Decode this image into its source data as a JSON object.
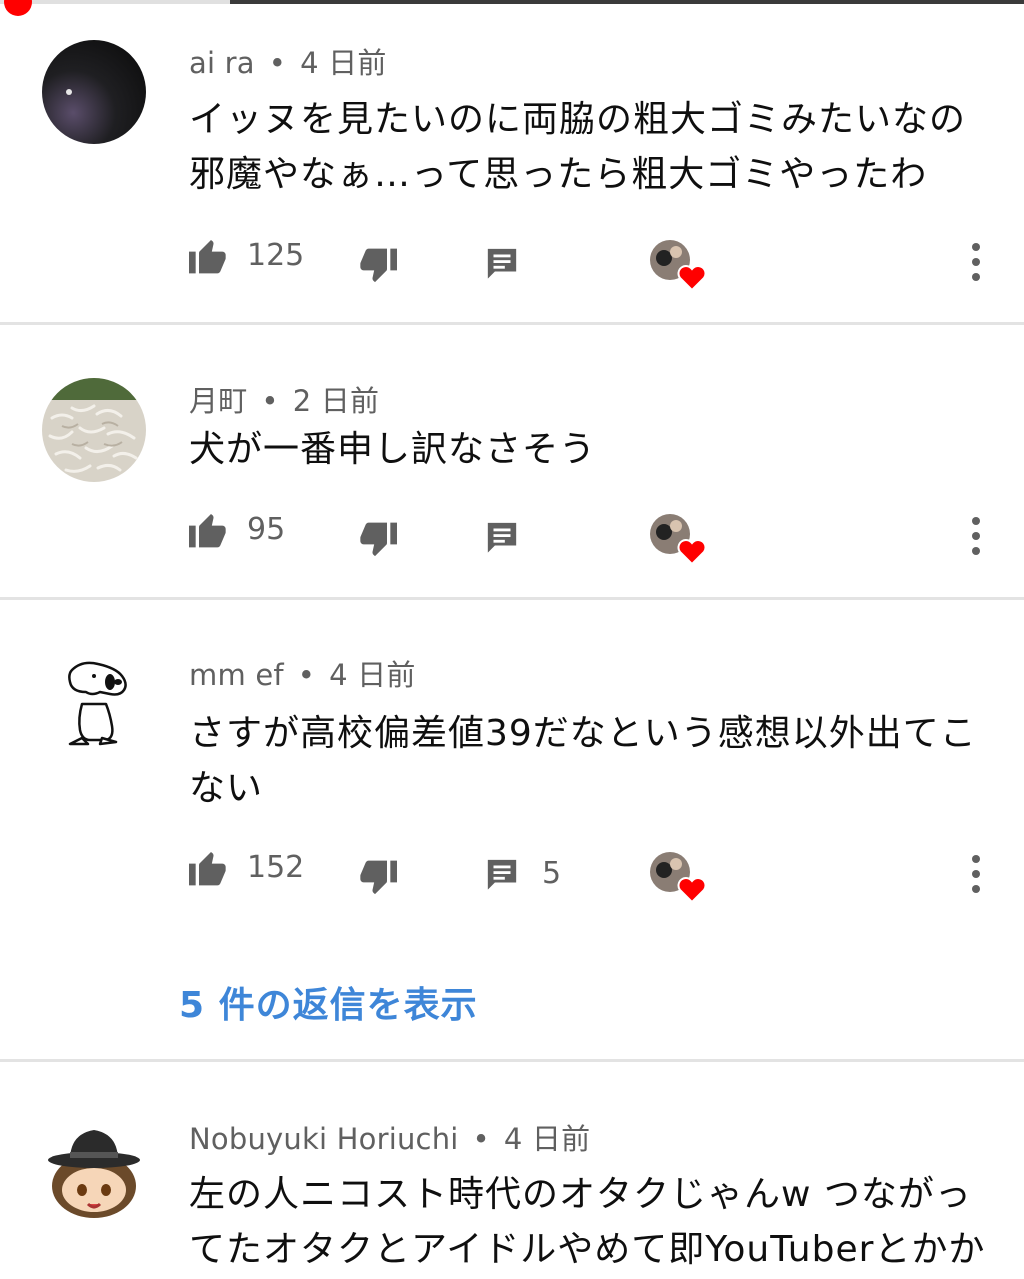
{
  "comments": [
    {
      "author": "ai ra",
      "time": "4 日前",
      "text_lines": [
        "イッヌを見たいのに両脇の粗大ゴミみたいなの",
        "邪魔やなぁ…って思ったら粗大ゴミやったわ"
      ],
      "likes": "125",
      "replies": ""
    },
    {
      "author": "月町",
      "time": "2 日前",
      "text_lines": [
        "犬が一番申し訳なさそう"
      ],
      "likes": "95",
      "replies": ""
    },
    {
      "author": "mm ef",
      "time": "4 日前",
      "text_lines": [
        "さすが高校偏差値39だなという感想以外出てこ",
        "ない"
      ],
      "likes": "152",
      "replies": "5"
    },
    {
      "author": "Nobuyuki Horiuchi",
      "time": "4 日前",
      "text_lines": [
        "左の人ニコスト時代のオタクじゃんw つながっ",
        "てたオタクとアイドルやめて即YouTuberとかか"
      ],
      "likes": "",
      "replies": ""
    }
  ],
  "dot_separator": "•",
  "view_replies_label": "5 件の返信を表示",
  "colors": {
    "accent_red": "#ff0000",
    "link_blue": "#3e86d8",
    "icon_gray": "#606060"
  },
  "icons": {
    "like": "thumb-up-icon",
    "dislike": "thumb-down-icon",
    "reply": "comment-icon",
    "creator_heart": "creator-heart-icon",
    "more": "more-vert-icon"
  }
}
